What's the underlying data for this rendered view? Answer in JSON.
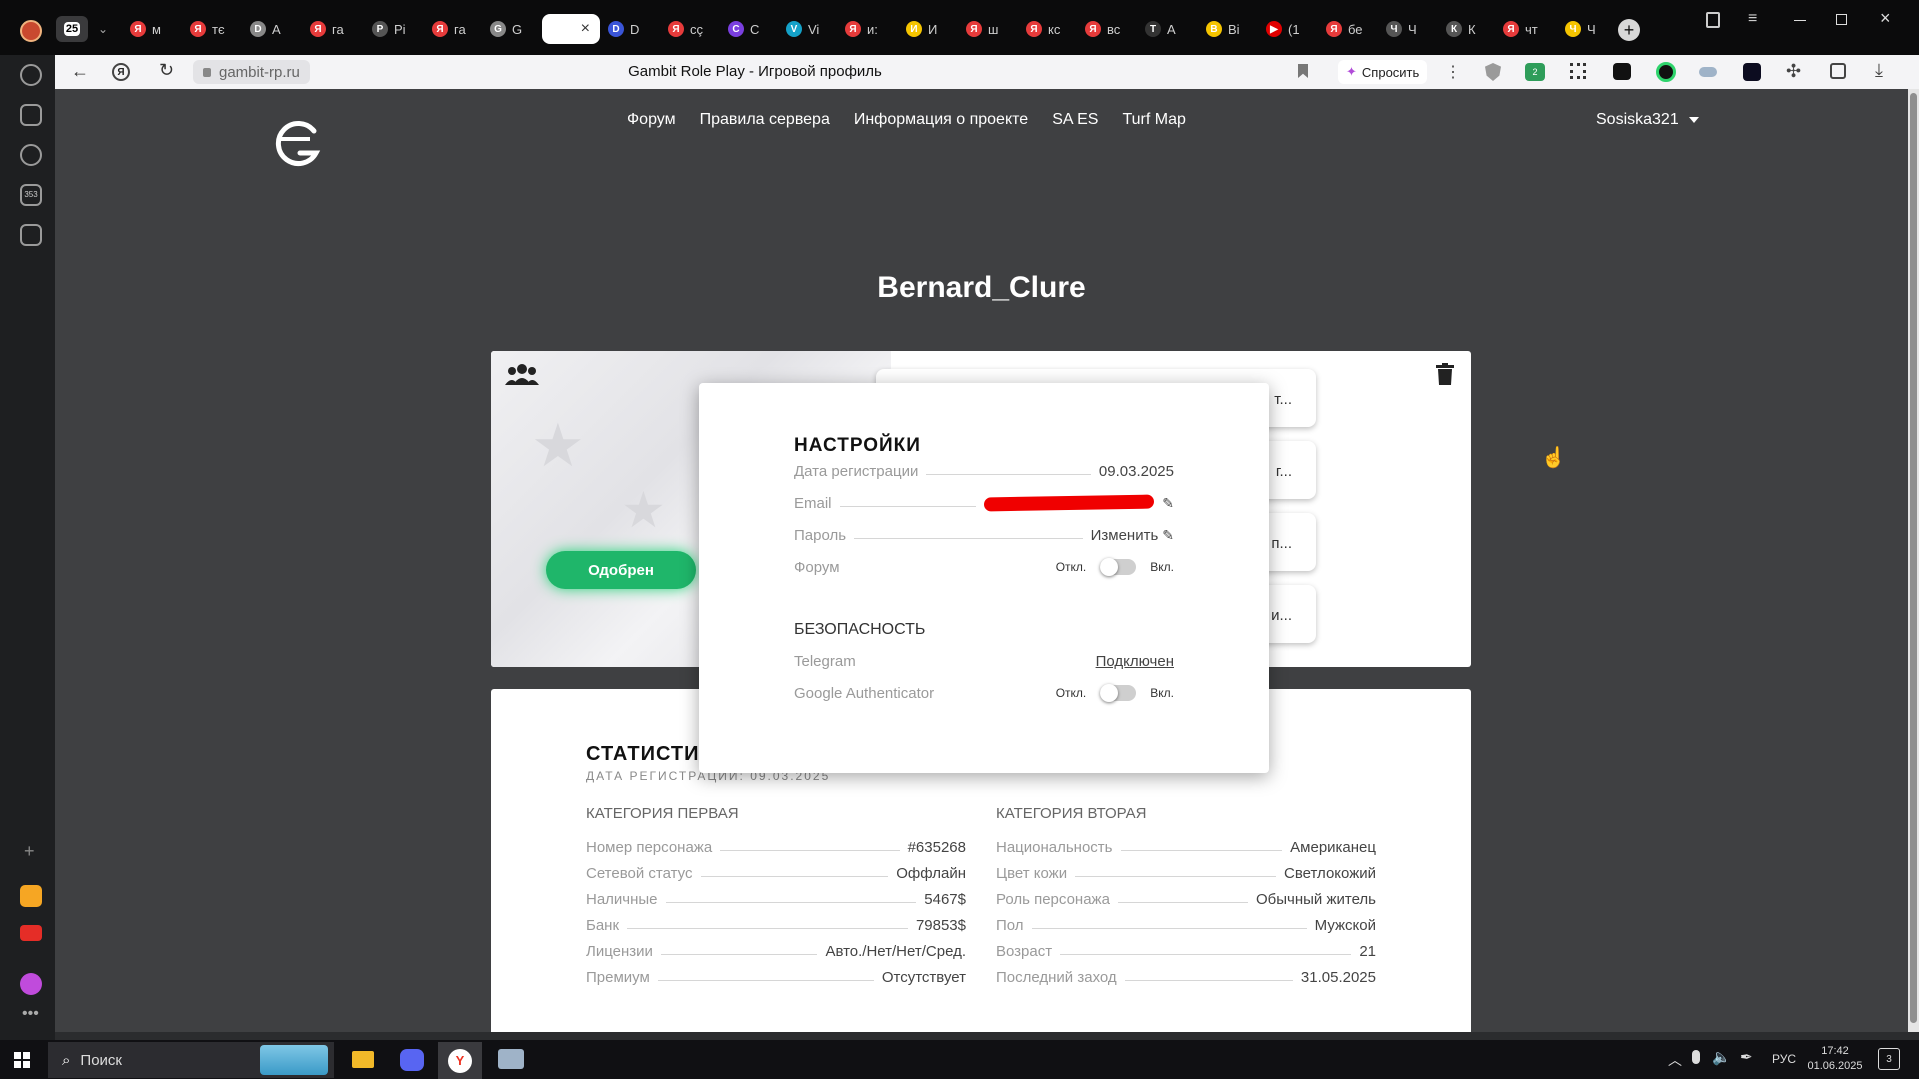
{
  "browser": {
    "tab_count_badge": "25",
    "tabs": [
      {
        "label": "м",
        "color": "#e63b3b",
        "glyph": "Я"
      },
      {
        "label": "тє",
        "color": "#e63b3b",
        "glyph": "Я"
      },
      {
        "label": "А",
        "color": "#888888",
        "glyph": "D"
      },
      {
        "label": "га",
        "color": "#e63b3b",
        "glyph": "Я"
      },
      {
        "label": "Pi",
        "color": "#555555",
        "glyph": "P"
      },
      {
        "label": "га",
        "color": "#e63b3b",
        "glyph": "Я"
      },
      {
        "label": "G",
        "color": "#888888",
        "glyph": "G"
      },
      {
        "label": "",
        "color": "#ffffff",
        "glyph": ""
      },
      {
        "label": "D",
        "color": "#3a55d8",
        "glyph": "D"
      },
      {
        "label": "cç",
        "color": "#e63b3b",
        "glyph": "Я"
      },
      {
        "label": "C",
        "color": "#7a3fe0",
        "glyph": "C"
      },
      {
        "label": "Vi",
        "color": "#14a1c8",
        "glyph": "V"
      },
      {
        "label": "и:",
        "color": "#e63b3b",
        "glyph": "Я"
      },
      {
        "label": "И",
        "color": "#f5c400",
        "glyph": "И"
      },
      {
        "label": "ш",
        "color": "#e63b3b",
        "glyph": "Я"
      },
      {
        "label": "кс",
        "color": "#e63b3b",
        "glyph": "Я"
      },
      {
        "label": "вс",
        "color": "#e63b3b",
        "glyph": "Я"
      },
      {
        "label": "A",
        "color": "#333333",
        "glyph": "T"
      },
      {
        "label": "Bi",
        "color": "#f5c400",
        "glyph": "B"
      },
      {
        "label": "(1",
        "color": "#e00000",
        "glyph": "▶"
      },
      {
        "label": "бе",
        "color": "#e63b3b",
        "glyph": "Я"
      },
      {
        "label": "Ч",
        "color": "#555555",
        "glyph": "Ч"
      },
      {
        "label": "К",
        "color": "#555555",
        "glyph": "К"
      },
      {
        "label": "чт",
        "color": "#e63b3b",
        "glyph": "Я"
      },
      {
        "label": "Ч",
        "color": "#f5c400",
        "glyph": "Ч"
      }
    ],
    "url": "gambit-rp.ru",
    "page_title": "Gambit Role Play - Игровой профиль",
    "ask_button": "Спросить",
    "ext_badge": "2"
  },
  "site": {
    "nav": [
      "Форум",
      "Правила сервера",
      "Информация о проекте",
      "SA ES",
      "Turf Map"
    ],
    "user": "Sosiska321"
  },
  "profile": {
    "name": "Bernard_Clure",
    "status_badge": "Одобрен",
    "side_cards": [
      "т...",
      "г...",
      "п...",
      "и..."
    ]
  },
  "settings": {
    "title": "НАСТРОЙКИ",
    "rows": [
      {
        "key": "Дата регистрации",
        "value": "09.03.2025"
      },
      {
        "key": "Email",
        "value": ""
      },
      {
        "key": "Пароль",
        "value": "Изменить"
      },
      {
        "key": "Форум",
        "off": "Откл.",
        "on": "Вкл."
      }
    ],
    "security_title": "БЕЗОПАСНОСТЬ",
    "security_rows": [
      {
        "key": "Telegram",
        "value": "Подключен"
      },
      {
        "key": "Google Authenticator",
        "off": "Откл.",
        "on": "Вкл."
      }
    ]
  },
  "stats": {
    "title": "СТАТИСТИКА",
    "subtitle": "ДАТА РЕГИСТРАЦИИ: 09.03.2025",
    "cat1_title": "КАТЕГОРИЯ ПЕРВАЯ",
    "cat1": [
      {
        "key": "Номер персонажа",
        "value": "#635268"
      },
      {
        "key": "Сетевой статус",
        "value": "Оффлайн"
      },
      {
        "key": "Наличные",
        "value": "5467$"
      },
      {
        "key": "Банк",
        "value": "79853$"
      },
      {
        "key": "Лицензии",
        "value": "Авто./Нет/Нет/Сред."
      },
      {
        "key": "Премиум",
        "value": "Отсутствует"
      }
    ],
    "cat2_title": "КАТЕГОРИЯ ВТОРАЯ",
    "cat2": [
      {
        "key": "Национальность",
        "value": "Американец"
      },
      {
        "key": "Цвет кожи",
        "value": "Светлокожий"
      },
      {
        "key": "Роль персонажа",
        "value": "Обычный житель"
      },
      {
        "key": "Пол",
        "value": "Мужской"
      },
      {
        "key": "Возраст",
        "value": "21"
      },
      {
        "key": "Последний заход",
        "value": "31.05.2025"
      }
    ]
  },
  "taskbar": {
    "search": "Поиск",
    "lang": "РУС",
    "time": "17:42",
    "date": "01.06.2025",
    "notif_count": "3"
  }
}
